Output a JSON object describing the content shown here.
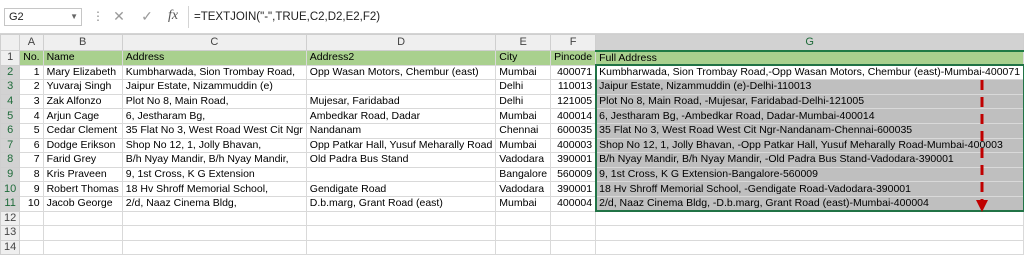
{
  "formula_bar": {
    "name_box": "G2",
    "cancel_glyph": "✕",
    "enter_glyph": "✓",
    "fx_glyph": "fx",
    "formula": "=TEXTJOIN(\"-\",TRUE,C2,D2,E2,F2)"
  },
  "columns": [
    "A",
    "B",
    "C",
    "D",
    "E",
    "F",
    "G",
    "H"
  ],
  "row_numbers": [
    "1",
    "2",
    "3",
    "4",
    "5",
    "6",
    "7",
    "8",
    "9",
    "10",
    "11",
    "12",
    "13",
    "14"
  ],
  "headers": {
    "no": "No.",
    "name": "Name",
    "address": "Address",
    "address2": "Address2",
    "city": "City",
    "pincode": "Pincode",
    "full_address": "Full Address"
  },
  "rows": [
    {
      "no": "1",
      "name": "Mary Elizabeth",
      "address": "Kumbharwada, Sion Trombay Road,",
      "address2": "Opp Wasan Motors, Chembur (east)",
      "city": "Mumbai",
      "pincode": "400071",
      "full": "Kumbharwada, Sion Trombay Road,-Opp Wasan Motors, Chembur (east)-Mumbai-400071"
    },
    {
      "no": "2",
      "name": "Yuvaraj Singh",
      "address": "Jaipur Estate, Nizammuddin (e)",
      "address2": "",
      "city": "Delhi",
      "pincode": "110013",
      "full": "Jaipur Estate, Nizammuddin (e)-Delhi-110013"
    },
    {
      "no": "3",
      "name": "Zak Alfonzo",
      "address": "Plot No 8, Main Road,",
      "address2": "Mujesar, Faridabad",
      "city": "Delhi",
      "pincode": "121005",
      "full": "Plot No 8, Main Road, -Mujesar, Faridabad-Delhi-121005"
    },
    {
      "no": "4",
      "name": "Arjun Cage",
      "address": "6, Jestharam Bg,",
      "address2": "Ambedkar Road, Dadar",
      "city": "Mumbai",
      "pincode": "400014",
      "full": "6, Jestharam Bg, -Ambedkar Road, Dadar-Mumbai-400014"
    },
    {
      "no": "5",
      "name": "Cedar Clement",
      "address": "35 Flat No 3, West Road West Cit Ngr",
      "address2": "Nandanam",
      "city": "Chennai",
      "pincode": "600035",
      "full": "35 Flat No 3, West Road West Cit Ngr-Nandanam-Chennai-600035"
    },
    {
      "no": "6",
      "name": "Dodge Erikson",
      "address": "Shop No 12, 1, Jolly Bhavan,",
      "address2": "Opp Patkar Hall, Yusuf Meharally Road",
      "city": "Mumbai",
      "pincode": "400003",
      "full": "Shop No 12, 1, Jolly Bhavan, -Opp Patkar Hall, Yusuf Meharally Road-Mumbai-400003"
    },
    {
      "no": "7",
      "name": "Farid Grey",
      "address": "B/h Nyay Mandir, B/h Nyay Mandir,",
      "address2": "Old Padra Bus Stand",
      "city": "Vadodara",
      "pincode": "390001",
      "full": "B/h Nyay Mandir, B/h Nyay Mandir, -Old Padra Bus Stand-Vadodara-390001"
    },
    {
      "no": "8",
      "name": "Kris Praveen",
      "address": "9, 1st Cross, K G Extension",
      "address2": "",
      "city": "Bangalore",
      "pincode": "560009",
      "full": "9, 1st Cross, K G Extension-Bangalore-560009"
    },
    {
      "no": "9",
      "name": "Robert Thomas",
      "address": "18 Hv Shroff Memorial School,",
      "address2": "Gendigate Road",
      "city": "Vadodara",
      "pincode": "390001",
      "full": "18 Hv Shroff Memorial School, -Gendigate Road-Vadodara-390001"
    },
    {
      "no": "10",
      "name": "Jacob George",
      "address": "2/d, Naaz Cinema Bldg,",
      "address2": "D.b.marg, Grant Road (east)",
      "city": "Mumbai",
      "pincode": "400004",
      "full": "2/d, Naaz Cinema Bldg, -D.b.marg, Grant Road (east)-Mumbai-400004"
    }
  ],
  "colors": {
    "header_fill": "#a9d08e",
    "selection_fill": "#bfbfbf",
    "selection_border": "#217346",
    "arrow": "#c00000"
  }
}
